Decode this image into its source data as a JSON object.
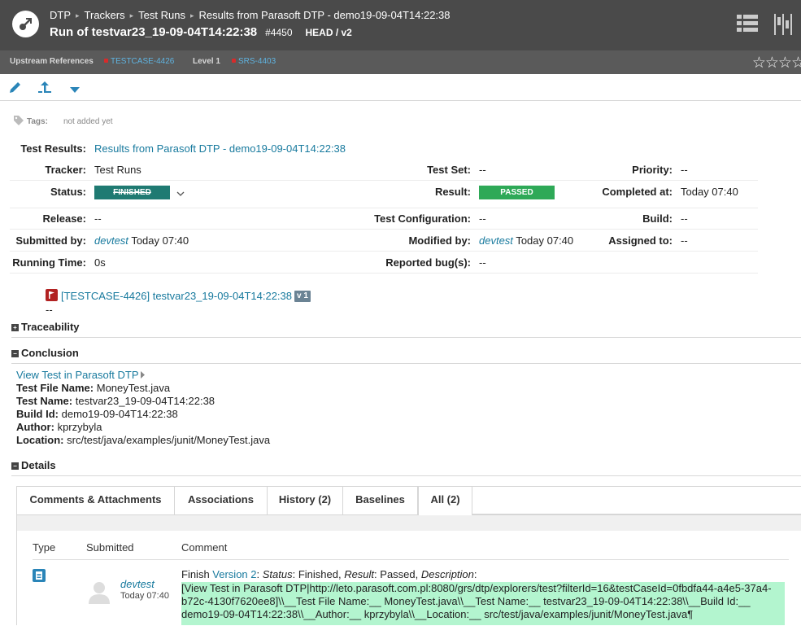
{
  "breadcrumb": {
    "items": [
      "DTP",
      "Trackers",
      "Test Runs",
      "Results from Parasoft DTP - demo19-09-04T14:22:38"
    ],
    "separator": "▸"
  },
  "header": {
    "title": "Run of testvar23_19-09-04T14:22:38",
    "item_number": "#4450",
    "branch": "HEAD / v2"
  },
  "upstream": {
    "label": "Upstream References",
    "ref1": "TESTCASE-4426",
    "level": "Level 1",
    "ref2": "SRS-4403",
    "stars": "☆☆☆☆"
  },
  "tags": {
    "label": "Tags:",
    "value": "not added yet"
  },
  "properties": {
    "test_results_label": "Test Results:",
    "test_results_value": "Results from Parasoft DTP - demo19-09-04T14:22:38",
    "tracker_label": "Tracker:",
    "tracker_value": "Test Runs",
    "test_set_label": "Test Set:",
    "test_set_value": "--",
    "priority_label": "Priority:",
    "priority_value": "--",
    "status_label": "Status:",
    "status_value": "FINISHED",
    "result_label": "Result:",
    "result_value": "PASSED",
    "completed_label": "Completed at:",
    "completed_value": "Today 07:40",
    "release_label": "Release:",
    "release_value": "--",
    "test_config_label": "Test Configuration:",
    "test_config_value": "--",
    "build_label": "Build:",
    "build_value": "--",
    "submitted_label": "Submitted by:",
    "submitted_user": "devtest",
    "submitted_time": "Today 07:40",
    "modified_label": "Modified by:",
    "modified_user": "devtest",
    "modified_time": "Today 07:40",
    "assigned_label": "Assigned to:",
    "assigned_value": "--",
    "running_label": "Running Time:",
    "running_value": "0s",
    "bugs_label": "Reported bug(s):",
    "bugs_value": "--"
  },
  "related": {
    "link": "[TESTCASE-4426] testvar23_19-09-04T14:22:38",
    "version": "v 1",
    "dash": "--"
  },
  "sections": {
    "traceability": "Traceability",
    "conclusion": "Conclusion",
    "details": "Details"
  },
  "conclusion": {
    "view_link": "View Test in Parasoft DTP",
    "file_label": "Test File Name:",
    "file_value": "MoneyTest.java",
    "name_label": "Test Name:",
    "name_value": "testvar23_19-09-04T14:22:38",
    "build_label": "Build Id:",
    "build_value": "demo19-09-04T14:22:38",
    "author_label": "Author:",
    "author_value": "kprzybyla",
    "location_label": "Location:",
    "location_value": "src/test/java/examples/junit/MoneyTest.java"
  },
  "tabs": [
    "Comments & Attachments",
    "Associations",
    "History (2)",
    "Baselines",
    "All (2)"
  ],
  "comments": {
    "col_type": "Type",
    "col_submitted": "Submitted",
    "col_comment": "Comment",
    "author": "devtest",
    "time": "Today 07:40",
    "line1_prefix": "Finish ",
    "line1_version": "Version 2",
    "line1_status_label": "Status",
    "line1_status": ": Finished, ",
    "line1_result_label": "Result",
    "line1_result": ": Passed, ",
    "line1_desc_label": "Description",
    "line1_desc_suffix": ":",
    "hl_line1": "[View Test in Parasoft DTP|http://leto.parasoft.com.pl:8080/grs/dtp/explorers/test?filterId=16&testCaseId=0fbdfa44-a4e5-37a4-",
    "hl_line2": "b72c-4130f7620ee8]\\\\__Test File Name:__ MoneyTest.java\\\\__Test Name:__ testvar23_19-09-04T14:22:38\\\\__Build Id:__",
    "hl_line3": "demo19-09-04T14:22:38\\\\__Author:__ kprzybyla\\\\__Location:__ src/test/java/examples/junit/MoneyTest.java¶"
  }
}
